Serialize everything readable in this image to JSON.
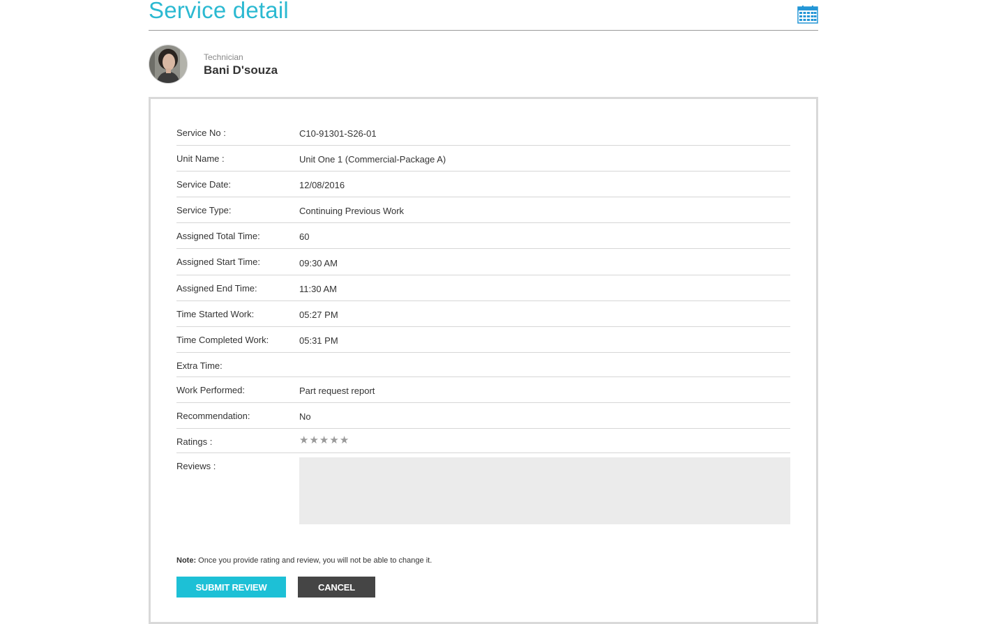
{
  "header": {
    "title": "Service detail",
    "calendar_icon": "calendar-icon",
    "accent_color": "#2bb9d1"
  },
  "technician": {
    "role": "Technician",
    "name": "Bani D'souza"
  },
  "details": [
    {
      "label": "Service No :",
      "value": "C10-91301-S26-01"
    },
    {
      "label": "Unit Name :",
      "value": "Unit One 1 (Commercial-Package A)"
    },
    {
      "label": "Service Date:",
      "value": "12/08/2016"
    },
    {
      "label": "Service Type:",
      "value": "Continuing Previous Work"
    },
    {
      "label": "Assigned Total Time:",
      "value": "60"
    },
    {
      "label": "Assigned Start Time:",
      "value": "09:30 AM"
    },
    {
      "label": "Assigned End Time:",
      "value": "11:30 AM"
    },
    {
      "label": "Time Started Work:",
      "value": "05:27 PM"
    },
    {
      "label": "Time Completed Work:",
      "value": "05:31 PM"
    },
    {
      "label": "Extra Time:",
      "value": ""
    },
    {
      "label": "Work Performed:",
      "value": "Part request report"
    },
    {
      "label": "Recommendation:",
      "value": "No"
    }
  ],
  "ratings": {
    "label": "Ratings :",
    "max": 5,
    "value": 0,
    "star_icon": "star-icon"
  },
  "reviews": {
    "label": "Reviews :",
    "value": ""
  },
  "note": {
    "prefix": "Note:",
    "text": " Once you provide rating and review, you will not be able to change it."
  },
  "buttons": {
    "submit": "SUBMIT REVIEW",
    "cancel": "CANCEL",
    "submit_color": "#1dc0d6",
    "cancel_color": "#454545"
  }
}
